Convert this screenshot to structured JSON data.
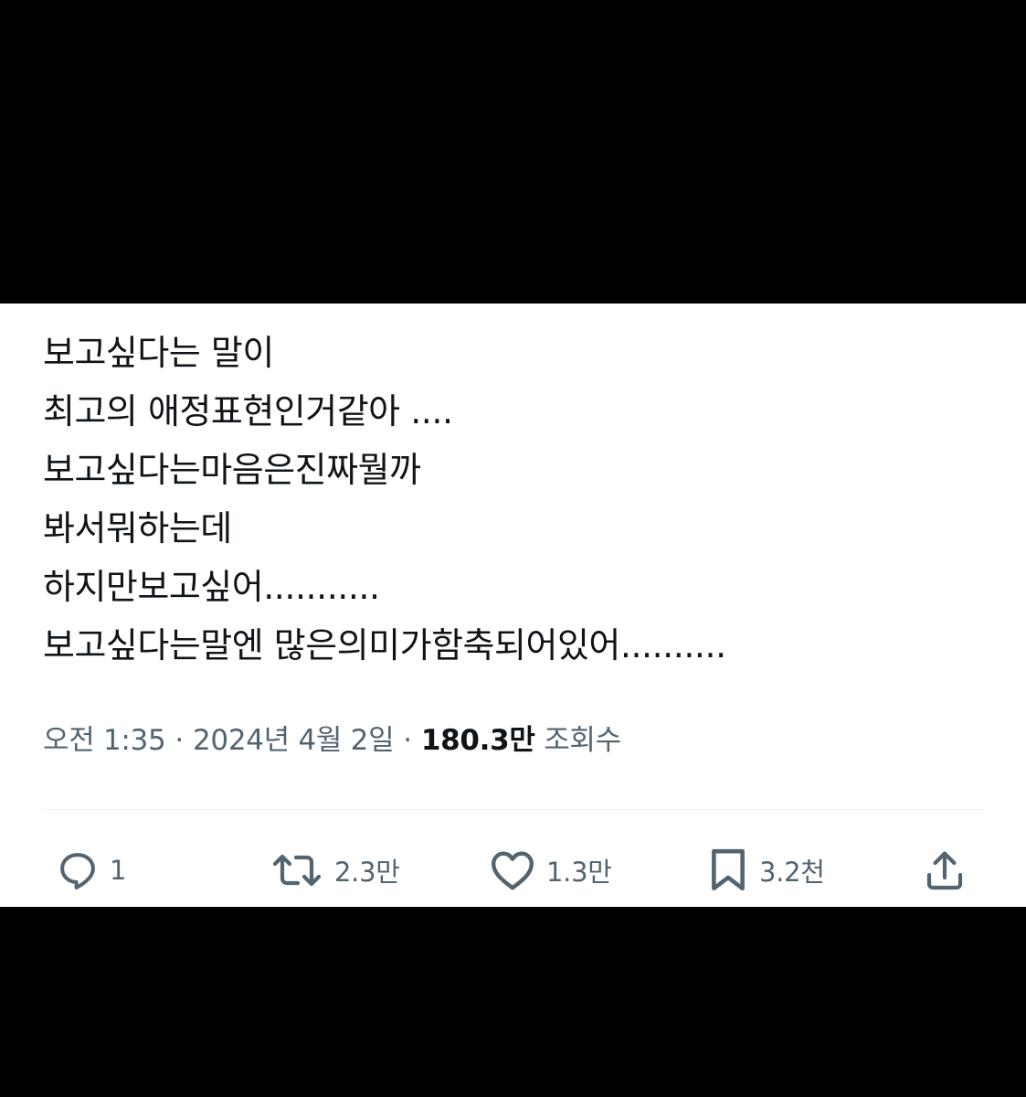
{
  "tweet": {
    "lines": [
      "보고싶다는 말이",
      "최고의 애정표현인거같아 ....",
      "보고싶다는마음은진짜뭘까",
      "봐서뭐하는데",
      "하지만보고싶어...........",
      "보고싶다는말엔 많은의미가함축되어있어.........."
    ],
    "time": "오전 1:35",
    "separator": "·",
    "date": "2024년 4월 2일",
    "views_count": "180.3만",
    "views_label": "조회수"
  },
  "actions": {
    "reply_count": "1",
    "retweet_count": "2.3만",
    "like_count": "1.3만",
    "bookmark_count": "3.2천"
  },
  "icons": {
    "reply": "reply-icon",
    "retweet": "retweet-icon",
    "like": "heart-icon",
    "bookmark": "bookmark-icon",
    "share": "share-icon"
  },
  "colors": {
    "background": "#000000",
    "card": "#ffffff",
    "text": "#0f1419",
    "secondary": "#536471",
    "divider": "#eff3f4"
  }
}
